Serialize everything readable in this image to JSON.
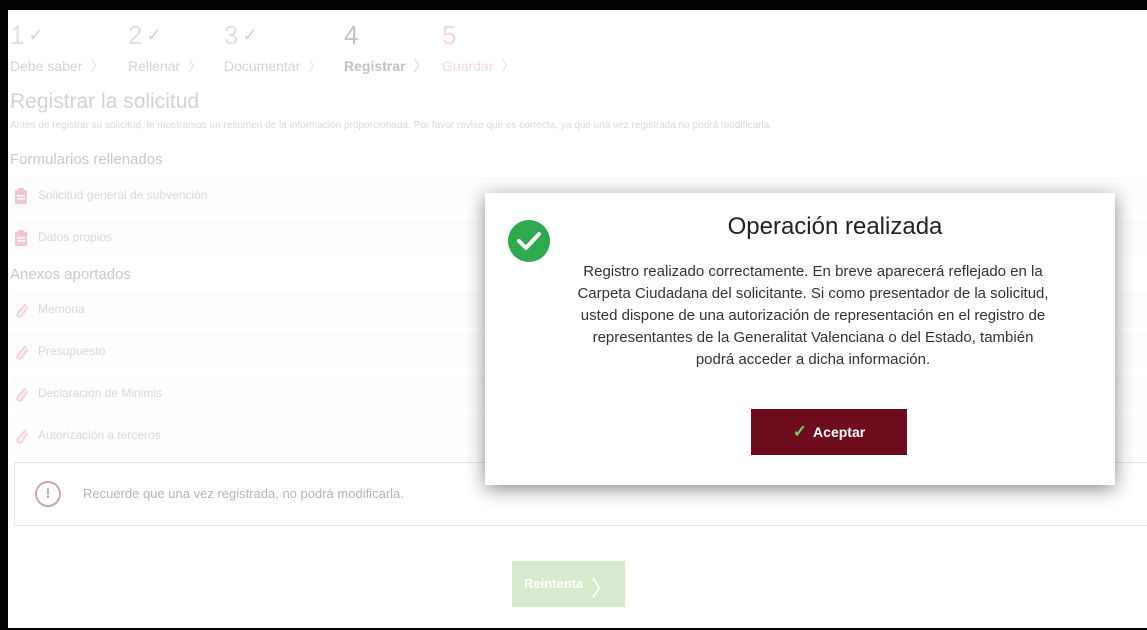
{
  "steps": [
    {
      "num": "1",
      "label": "Debe saber",
      "done": true
    },
    {
      "num": "2",
      "label": "Rellenar",
      "done": true
    },
    {
      "num": "3",
      "label": "Documentar",
      "done": true
    },
    {
      "num": "4",
      "label": "Registrar",
      "done": false
    },
    {
      "num": "5",
      "label": "Guardar",
      "done": false
    }
  ],
  "page": {
    "title": "Registrar la solicitud",
    "intro": "Antes de registrar su solicitud, le mostramos un resumen de la información proporcionada. Por favor revise que es correcta, ya que una vez registrada no podrá modificarla."
  },
  "forms": {
    "heading": "Formularios rellenados",
    "items": [
      "Solicitud general de subvención",
      "Datos propios"
    ]
  },
  "annexes": {
    "heading": "Anexos aportados",
    "items": [
      "Memoria",
      "Presupuesto",
      "Declaración de Minimis",
      "Autorización a terceros"
    ]
  },
  "alert": {
    "text": "Recuerde que una vez registrada, no podrá modificarla."
  },
  "retry": {
    "label": "Reintenta"
  },
  "modal": {
    "title": "Operación realizada",
    "message": "Registro realizado correctamente. En breve aparecerá reflejado en la Carpeta Ciudadana del solicitante. Si como presentador de la solicitud, usted dispone de una autorización de representación en el registro de representantes de la Generalitat Valenciana o del Estado, también podrá acceder a dicha información.",
    "button": "Aceptar"
  },
  "colors": {
    "accent": "#6e0c1e",
    "success": "#2eaa4e",
    "retry": "#a9d18e"
  }
}
